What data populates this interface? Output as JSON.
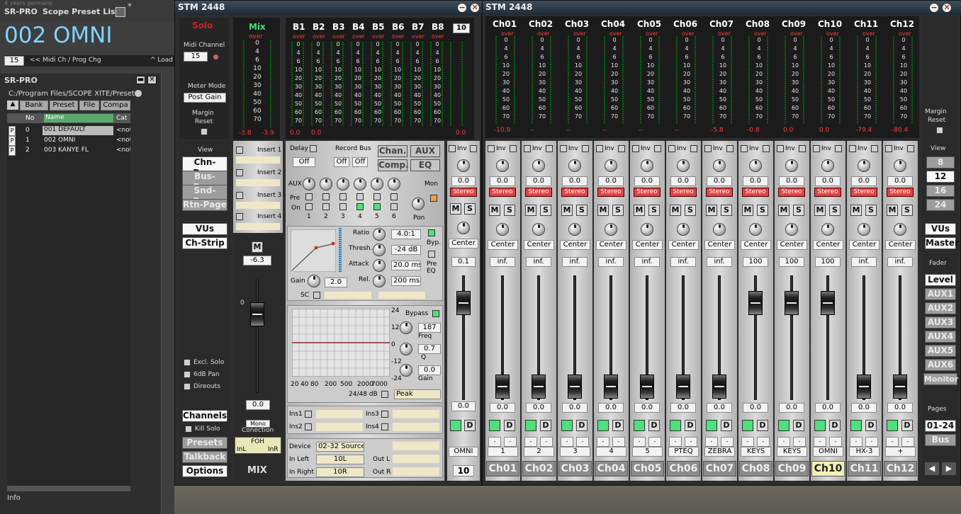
{
  "preset_list": {
    "title": "SR-PRO",
    "list_title": "Scope Preset List",
    "tagline": "4 years germany",
    "preset_name": "002 OMNI",
    "midi_num": "15",
    "midi_label": "<< Midi Ch / Prog Chg",
    "load_label": "^ Load"
  },
  "srpro": {
    "title": "SR-PRO",
    "path": "C:/Program Files/SCOPE XITE/Preset",
    "cols": [
      "Bank",
      "Preset",
      "File",
      "Compa"
    ],
    "subcols": [
      "No",
      "Name",
      "Cat"
    ],
    "rows": [
      {
        "flag": "P",
        "no": "0",
        "name": "001 DEFAULT",
        "cat": "<not"
      },
      {
        "flag": "P",
        "no": "1",
        "name": "002 OMNI",
        "cat": "<not"
      },
      {
        "flag": "P",
        "no": "2",
        "name": "003 KANYE FL",
        "cat": "<not"
      }
    ],
    "info": "Info"
  },
  "stm": {
    "title": "STM 2448",
    "solo": "Solo",
    "mix": "Mix",
    "midi_label": "Midi Channel",
    "midi_val": "15",
    "meter_mode": "Meter Mode",
    "meter_val": "Post Gain",
    "margin": "Margin",
    "reset": "Reset",
    "buses": [
      "B1",
      "B2",
      "B3",
      "B4",
      "B5",
      "B6",
      "B7",
      "B8"
    ],
    "bus_num": "10",
    "over": "over",
    "scale": [
      "0",
      "4",
      "6",
      "10",
      "20",
      "30",
      "40",
      "50",
      "60",
      "70"
    ],
    "mix_vals": [
      "-3.8",
      "-3.9"
    ],
    "bus_vals": [
      "0.0",
      "0.0",
      "0.0"
    ],
    "bus_last": "0.0",
    "view": "View",
    "pages": [
      "Chn-Page",
      "Bus-Page",
      "Snd-Page",
      "Rtn-Page"
    ],
    "vus": "VUs",
    "chstrip": "Ch-Strip",
    "inserts": [
      "Insert 1",
      "Insert 2",
      "Insert 3",
      "Insert 4"
    ],
    "delay": "Delay",
    "delay_val": "Off",
    "record_bus": "Record Bus",
    "rec_vals": [
      "Off",
      "Off"
    ],
    "chan": "Chan.",
    "aux": "AUX",
    "comp": "Comp.",
    "eq": "EQ",
    "aux_label": "AUX",
    "mon": "Mon",
    "pre": "Pre",
    "on": "On",
    "pon": "Pon",
    "aux_nums": [
      "1",
      "2",
      "3",
      "4",
      "5",
      "6"
    ],
    "ratio": "Ratio",
    "ratio_val": "4.0:1",
    "thresh": "Thresh.",
    "thresh_val": "-24 dB",
    "attack": "Attack",
    "attack_val": "20.0 ms",
    "gain": "Gain",
    "gain_val": "2.0",
    "rel": "Rel.",
    "rel_val": "200 ms",
    "byp": "Byp.",
    "pre_eq": "Pre EQ",
    "sc": "SC",
    "eq_bypass": "Bypass",
    "eq_freq": "187",
    "eq_freq_label": "Freq",
    "eq_q": "0.7",
    "eq_q_label": "Q",
    "eq_gain": "0.0",
    "eq_gain_label": "Gain",
    "eq_y": [
      "24",
      "12",
      "0",
      "-12",
      "-24"
    ],
    "eq_x": [
      "20",
      "40",
      "80",
      "200",
      "500",
      "2000",
      "7000"
    ],
    "eq_range": "24/48 dB",
    "eq_type": "Peak",
    "ins_labels": [
      "Ins1",
      "Ins3",
      "Ins2",
      "Ins4"
    ],
    "device": "Device",
    "device_val": "02-32 Source",
    "in_left": "In Left",
    "in_left_val": "10L",
    "in_right": "In Right",
    "in_right_val": "10R",
    "out_l": "Out L",
    "out_r": "Out R",
    "mono": "Mono",
    "connection": "Conection",
    "foh": "FOH",
    "inl": "InL",
    "inr": "InR",
    "mix_label": "MIX",
    "master_m": "M",
    "master_val": "-6.3",
    "master_fader_val": "0.0",
    "master_0": "0",
    "excl_solo": "Excl. Solo",
    "pan_law": "6dB Pan",
    "direct_outs": "Direouts",
    "channels": "Channels",
    "kill_solo": "Kill Solo",
    "presets": "Presets",
    "talkback": "Talkback",
    "options": "Options",
    "ch_inv": "Inv",
    "ch_gain": "0.0",
    "ch_stereo": "Stereo",
    "ch_m": "M",
    "ch_s": "S",
    "ch_center": "Center",
    "ch_send": "0.1",
    "ch_fader": "0.0",
    "ch_d": "D",
    "ch_name": "OMNI",
    "ch_num": "10"
  },
  "stm2": {
    "title": "STM 2448",
    "channels": [
      {
        "name": "Ch01",
        "peak": "-10.9",
        "send": "inf.",
        "fader": "0.0",
        "label": "1"
      },
      {
        "name": "Ch02",
        "peak": "--",
        "send": "inf.",
        "fader": "0.0",
        "label": "2"
      },
      {
        "name": "Ch03",
        "peak": "--",
        "send": "inf.",
        "fader": "0.0",
        "label": "3"
      },
      {
        "name": "Ch04",
        "peak": "--",
        "send": "inf.",
        "fader": "0.0",
        "label": "4"
      },
      {
        "name": "Ch05",
        "peak": "--",
        "send": "inf.",
        "fader": "0.0",
        "label": "5"
      },
      {
        "name": "Ch06",
        "peak": "--",
        "send": "inf.",
        "fader": "0.0",
        "label": "PTEQ"
      },
      {
        "name": "Ch07",
        "peak": "-5.8",
        "send": "inf.",
        "fader": "0.0",
        "label": "ZEBRA"
      },
      {
        "name": "Ch08",
        "peak": "-0.8",
        "send": "100",
        "fader": "0.0",
        "label": "KEYS"
      },
      {
        "name": "Ch09",
        "peak": "0.0",
        "send": "100",
        "fader": "0.0",
        "label": "KEYS"
      },
      {
        "name": "Ch10",
        "peak": "0.0",
        "send": "100",
        "fader": "0.0",
        "label": "OMNI"
      },
      {
        "name": "Ch11",
        "peak": "-79.4",
        "send": "inf.",
        "fader": "0.0",
        "label": "HX-3"
      },
      {
        "name": "Ch12",
        "peak": "-80.4",
        "send": "inf.",
        "fader": "0.0",
        "label": "+"
      }
    ],
    "selected": "Ch10",
    "dash": "-",
    "gain": "0.0",
    "stereo": "Stereo",
    "inv": "Inv",
    "center": "Center",
    "d": "D",
    "m": "M",
    "s": "S",
    "over": "over",
    "scale": [
      "0",
      "4",
      "6",
      "10",
      "20",
      "30",
      "40",
      "50",
      "60",
      "70"
    ],
    "margin": "Margin",
    "reset": "Reset",
    "view": "View",
    "view_nums": [
      "8",
      "12",
      "16",
      "24"
    ],
    "view_active": "12",
    "vus": "VUs",
    "master": "Master",
    "fader": "Fader",
    "fader_modes": [
      "Level",
      "AUX1",
      "AUX2",
      "AUX3",
      "AUX4",
      "AUX5",
      "AUX6",
      "Monitor"
    ],
    "pages": "Pages",
    "page_val": "01-24",
    "bus": "Bus"
  }
}
